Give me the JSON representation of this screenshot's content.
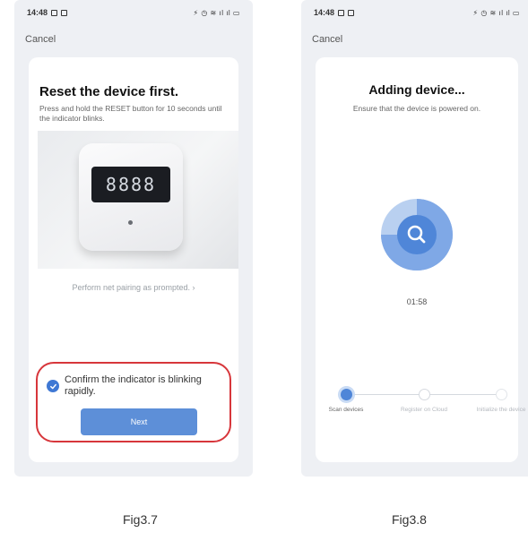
{
  "left_screen": {
    "status": {
      "time": "14:48",
      "right": "⚡ ◷ ≋ ıl ıl ▭"
    },
    "cancel_label": "Cancel",
    "title": "Reset the device first.",
    "description": "Press and hold the RESET button for 10 seconds until the indicator blinks.",
    "device_display": "8888",
    "prompt_link": "Perform net pairing as prompted. ›",
    "confirm_text": "Confirm the indicator is blinking rapidly.",
    "next_label": "Next"
  },
  "right_screen": {
    "status": {
      "time": "14:48",
      "right": "⚡ ◷ ≋ ıl ıl ▭"
    },
    "cancel_label": "Cancel",
    "title": "Adding device...",
    "description": "Ensure that the device is powered on.",
    "timer": "01:58",
    "steps": [
      {
        "label": "Scan devices",
        "state": "active"
      },
      {
        "label": "Register on Cloud",
        "state": "pending"
      },
      {
        "label": "Initialize the device",
        "state": "pending"
      }
    ]
  },
  "captions": {
    "left": "Fig3.7",
    "right": "Fig3.8"
  },
  "colors": {
    "accent": "#5d8fd8",
    "highlight": "#d7363b",
    "scan": "#4f86d8"
  }
}
